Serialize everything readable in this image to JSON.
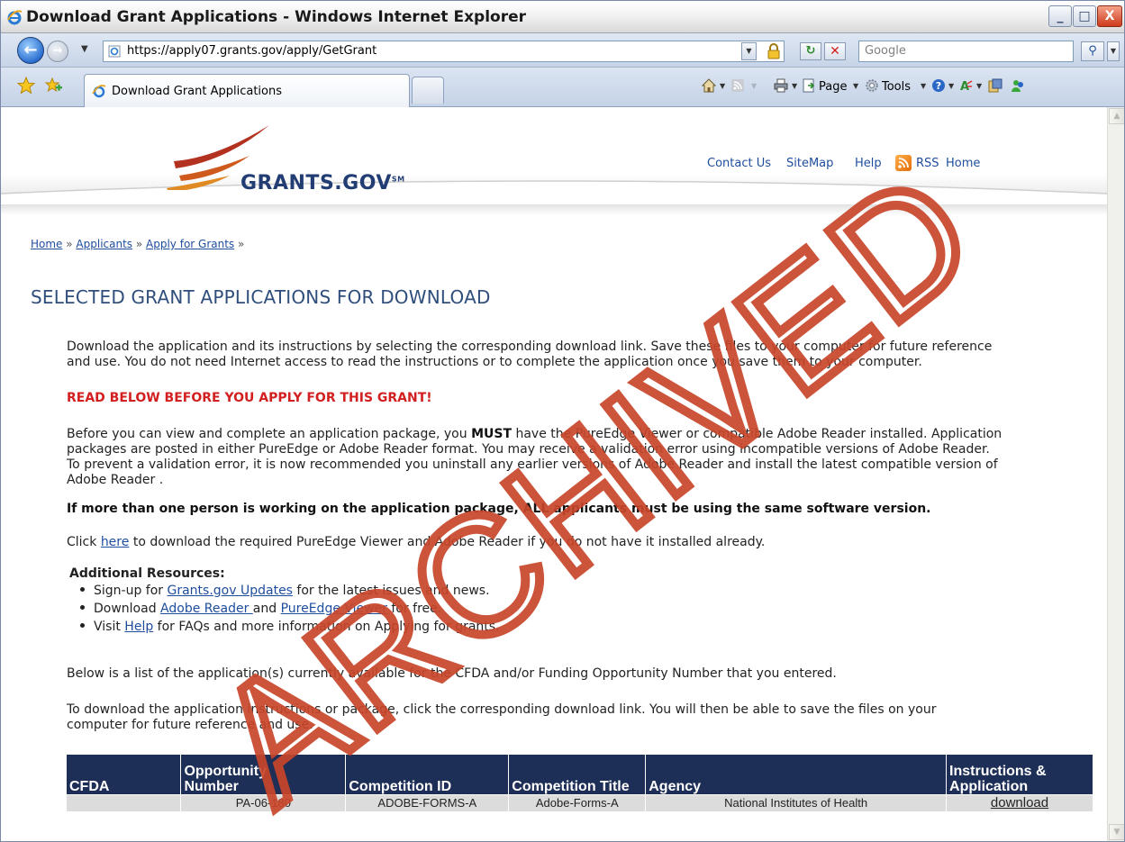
{
  "window": {
    "title": "Download Grant Applications - Windows Internet Explorer",
    "controls": {
      "minimize": "_",
      "maximize": "□",
      "close": "X"
    }
  },
  "address_bar": {
    "url": "https://apply07.grants.gov/apply/GetGrant",
    "search_placeholder": "Google"
  },
  "tabs": [
    {
      "label": "Download Grant Applications",
      "active": true
    }
  ],
  "command_bar": {
    "page": "Page",
    "tools": "Tools"
  },
  "site": {
    "logo": "GRANTS.GOV",
    "logo_mark": "SM",
    "top_nav": [
      "Contact Us",
      "SiteMap",
      "Help",
      "RSS",
      "Home"
    ]
  },
  "breadcrumb": [
    "Home",
    "Applicants",
    "Apply for Grants"
  ],
  "page": {
    "title": "SELECTED GRANT APPLICATIONS FOR DOWNLOAD",
    "intro_line1": "Download the application and its instructions by selecting the corresponding download link. Save these files to your computer for future reference",
    "intro_line2": "and use. You do not need Internet access to read the instructions or to complete the application once you save them to your computer.",
    "warning": "READ BELOW BEFORE YOU APPLY FOR THIS GRANT!",
    "req_line1_a": "Before you can view and complete an application package, you ",
    "req_line1_b": "MUST",
    "req_line1_c": " have the PureEdge Viewer or compatible Adobe Reader installed. Application",
    "req_line2": "packages are posted in either PureEdge or Adobe Reader format. You may receive a validation error using incompatible versions of Adobe Reader.",
    "req_line3": "To prevent a validation error, it is now recommended you uninstall any earlier versions of Adobe Reader and install the latest compatible version of",
    "req_line4": "Adobe Reader .",
    "same_version": "If more than one person is working on the application package, ALL applicants must be using the same software version.",
    "click_a": "Click ",
    "click_link": "here",
    "click_b": " to download the required PureEdge Viewer and Adobe Reader if you do not have it installed already.",
    "resources_title": "Additional Resources:",
    "res1_a": "Sign-up for ",
    "res1_link": "Grants.gov Updates",
    "res1_b": " for the latest issues and news.",
    "res2_a": "Download ",
    "res2_link1": "Adobe Reader ",
    "res2_mid": "and ",
    "res2_link2": "PureEdge Viewer",
    "res2_b": " for free.",
    "res3_a": "Visit ",
    "res3_link": "Help",
    "res3_b": " for FAQs and more information on Applying for grants.",
    "below_list": "Below is a list of the application(s) currently available for the CFDA and/or Funding Opportunity Number that you entered.",
    "to_download_1": "To download the application instructions or package, click the corresponding download link. You will then be able to save the files on your",
    "to_download_2": "computer for future reference and use."
  },
  "table": {
    "headers": {
      "cfda": "CFDA",
      "opp_1": "Opportunity",
      "opp_2": "Number",
      "comp_id": "Competition ID",
      "comp_title": "Competition Title",
      "agency": "Agency",
      "instr_1": "Instructions &",
      "instr_2": "Application"
    },
    "rows": [
      {
        "cfda": "",
        "opportunity_number": "PA-06-180",
        "competition_id": "ADOBE-FORMS-A",
        "competition_title": "Adobe-Forms-A",
        "agency": "National Institutes of Health",
        "download": "download"
      }
    ]
  },
  "watermark": "ARCHIVED",
  "colors": {
    "table_header": "#1e2f57",
    "warning_red": "#d21f1f",
    "link_blue": "#1f4d9e",
    "watermark": "#c8452a"
  }
}
